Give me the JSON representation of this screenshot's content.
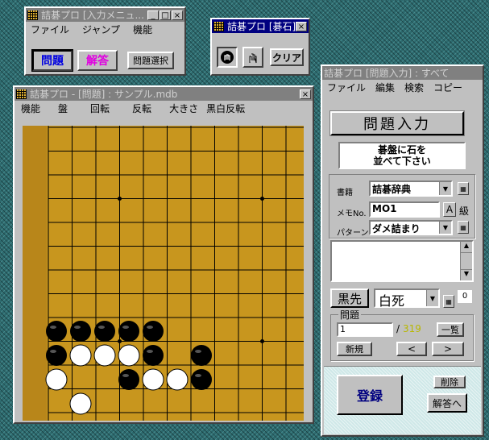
{
  "colors": {
    "board": "#c8961e",
    "title_active": "#000080",
    "title_inactive": "#808080",
    "panel": "#c0c0c0",
    "count": "#b8b800"
  },
  "input_menu_window": {
    "title": "詰碁プロ [入力メニュ...",
    "menu": [
      "ファイル",
      "ジャンプ",
      "機能"
    ],
    "problem_button": "問題",
    "answer_button": "解答",
    "select_button": "問題選択"
  },
  "stone_window": {
    "title": "詰碁プロ [碁石]",
    "clear_button": "クリア"
  },
  "board_window": {
    "title": "詰碁プロ - [問題] : サンプル.mdb",
    "menu": [
      "機能",
      "盤",
      "回転",
      "反転",
      "大きさ",
      "黒白反転"
    ]
  },
  "input_window": {
    "title": "詰碁プロ [問題入力] : すべて",
    "menu": [
      "ファイル",
      "編集",
      "検索",
      "コピー"
    ],
    "header": "問題入力",
    "instruction_line1": "碁盤に石を",
    "instruction_line2": "並べて下さい",
    "book_label": "書籍",
    "book_value": "詰碁辞典",
    "memo_label": "メモNo.",
    "memo_value": "MO1",
    "grade_letter": "A",
    "grade_suffix": "級",
    "pattern_label": "パターン",
    "pattern_value": "ダメ詰まり",
    "first_button": "黒先",
    "result_value": "白死",
    "hint_count": "0",
    "problem_group": "問題",
    "problem_number": "1",
    "problem_total": "319",
    "list_button": "一覧",
    "new_button": "新規",
    "prev_button": "<",
    "next_button": ">",
    "register_button": "登録",
    "delete_button": "削除",
    "to_answer_button": "解答へ"
  },
  "board": {
    "size": 19,
    "hoshi": [
      [
        3,
        3
      ],
      [
        3,
        9
      ],
      [
        3,
        15
      ],
      [
        9,
        3
      ],
      [
        9,
        9
      ],
      [
        9,
        15
      ],
      [
        15,
        3
      ],
      [
        15,
        9
      ],
      [
        15,
        15
      ]
    ],
    "black": [
      [
        0,
        15
      ],
      [
        1,
        15
      ],
      [
        2,
        15
      ],
      [
        3,
        15
      ],
      [
        4,
        15
      ],
      [
        0,
        16
      ],
      [
        4,
        16
      ],
      [
        6,
        16
      ],
      [
        3,
        17
      ],
      [
        6,
        17
      ]
    ],
    "white": [
      [
        1,
        16
      ],
      [
        2,
        16
      ],
      [
        3,
        16
      ],
      [
        0,
        17
      ],
      [
        4,
        17
      ],
      [
        5,
        17
      ],
      [
        1,
        18
      ]
    ]
  }
}
